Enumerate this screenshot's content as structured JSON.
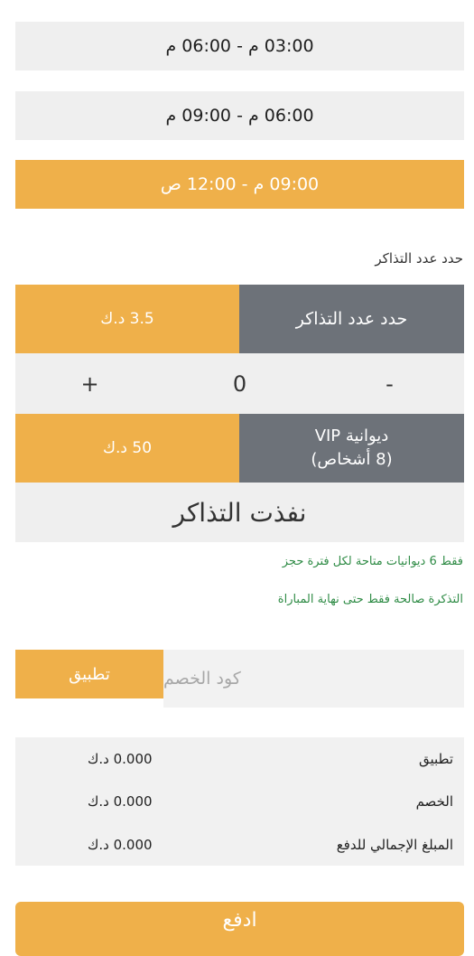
{
  "time_slots": [
    {
      "label": "03:00 م - 06:00 م",
      "selected": false
    },
    {
      "label": "06:00 م - 09:00 م",
      "selected": false
    },
    {
      "label": "09:00 م - 12:00 ص",
      "selected": true
    }
  ],
  "tickets": {
    "section_label": "حدد عدد التذاكر",
    "regular_title": "حدد عدد التذاكر",
    "regular_price": "3.5 د.ك",
    "decrement": "-",
    "quantity": "0",
    "increment": "+",
    "vip_title_line1": "ديوانية VIP",
    "vip_title_line2": "(8 أشخاص)",
    "vip_price": "50 د.ك",
    "soldout": "نفذت التذاكر",
    "note_availability": "فقط 6 ديوانيات متاحة لكل فترة حجز",
    "note_validity": "التذكرة صالحة فقط حتى نهاية المباراة"
  },
  "coupon": {
    "placeholder": "كود الخصم",
    "apply_label": "تطبيق"
  },
  "summary": {
    "rows": [
      {
        "label": "تطبيق",
        "value": "0.000 د.ك"
      },
      {
        "label": "الخصم",
        "value": "0.000 د.ك"
      },
      {
        "label": "المبلغ الإجمالي للدفع",
        "value": "0.000 د.ك"
      }
    ]
  },
  "pay_button": {
    "label": "ادفع"
  },
  "colors": {
    "accent": "#efb04a",
    "dark_cell": "#6d7279",
    "light_bg": "#efefef",
    "note_green": "#2e8b45"
  }
}
